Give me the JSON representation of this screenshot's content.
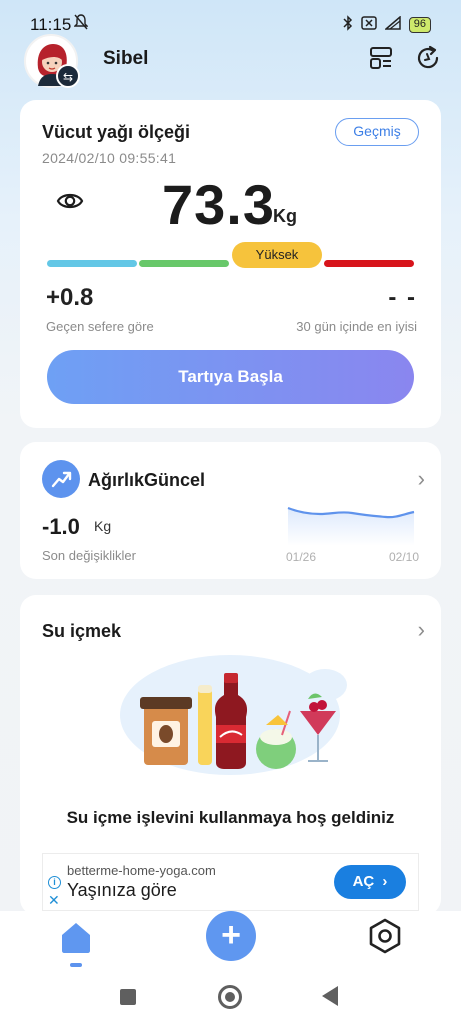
{
  "status_bar": {
    "time": "11:15",
    "battery": "96",
    "icons": [
      "alarm-off-icon",
      "bluetooth-icon",
      "sim-x-icon",
      "signal-icon",
      "battery-icon"
    ]
  },
  "header": {
    "user_name": "Sibel"
  },
  "body_fat": {
    "title": "Vücut yağı ölçeği",
    "date": "2024/02/10 09:55:41",
    "history_label": "Geçmiş",
    "weight": "73.3",
    "unit": "Kg",
    "status": "Yüksek",
    "diff_value": "+0.8",
    "diff_label": "Geçen sefere göre",
    "best_value": "- -",
    "best_label": "30 gün içinde en iyisi",
    "start_label": "Tartıya Başla",
    "colors": {
      "low": "#63c7e6",
      "normal": "#68c86a",
      "high": "#f6c33c",
      "very_high": "#d7141b"
    }
  },
  "weight_card": {
    "title": "AğırlıkGüncel",
    "value": "-1.0",
    "unit": "Kg",
    "label": "Son değişiklikler",
    "date_start": "01/26",
    "date_end": "02/10"
  },
  "water_card": {
    "title": "Su içmek",
    "welcome": "Su içme işlevini kullanmaya hoş geldiniz"
  },
  "ad": {
    "domain": "betterme-home-yoga.com",
    "headline": "Yaşınıza göre",
    "button_label": "AÇ"
  },
  "bottom_nav": {
    "items": [
      "home-icon",
      "add-icon",
      "settings-icon"
    ]
  }
}
